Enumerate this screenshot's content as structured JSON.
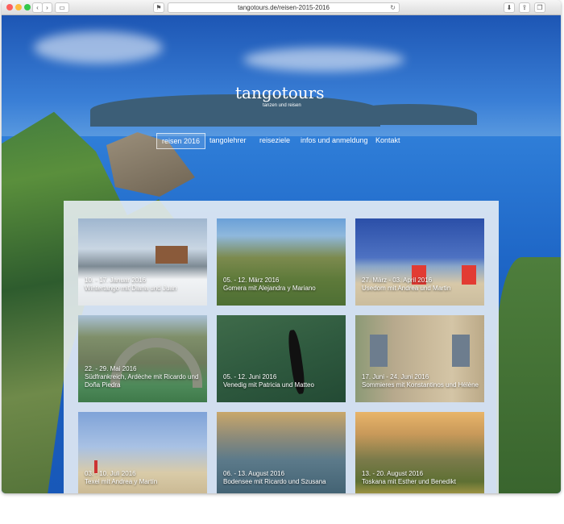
{
  "browser": {
    "address": "tangotours.de/reisen-2015-2016"
  },
  "site": {
    "logo_name": "tangotours",
    "logo_tagline": "tanzen und reisen"
  },
  "menu": [
    {
      "label": "reisen 2016",
      "active": true
    },
    {
      "label": "tangolehrer",
      "active": false
    },
    {
      "label": "reiseziele",
      "active": false
    },
    {
      "label": "infos und anmeldung",
      "active": false
    },
    {
      "label": "Kontakt",
      "active": false
    }
  ],
  "trips": [
    {
      "caption": "10. - 17. Januar 2016\nWintertango mit Diana und Juan"
    },
    {
      "caption": "05. - 12. März 2016\nGomera mit Alejandra y Mariano"
    },
    {
      "caption": "27. März - 03. April 2016\nUsedom mit Andrea und Martin"
    },
    {
      "caption": "22. - 29. Mai 2016\nSüdfrankreich, Ardèche mit Ricardo und Doña Piedra"
    },
    {
      "caption": "05. - 12. Juni 2016\nVenedig mit Patricia und Matteo"
    },
    {
      "caption": "17. Juni - 24. Juni 2016\nSommieres mit Konstantinos und Hélène"
    },
    {
      "caption": "03. - 10. Juli 2016\nTexel mit Andrea y Martín"
    },
    {
      "caption": "06. - 13. August 2016\nBodensee mit Ricardo und Szusana"
    },
    {
      "caption": "13. - 20. August 2016\nToskana mit Esther und Benedikt"
    }
  ],
  "icons": {
    "back": "chevron-left-icon",
    "forward": "chevron-right-icon",
    "sidebar": "sidebar-icon",
    "reload": "reload-icon",
    "download": "download-icon",
    "share": "share-icon",
    "tabs": "tabs-icon"
  }
}
